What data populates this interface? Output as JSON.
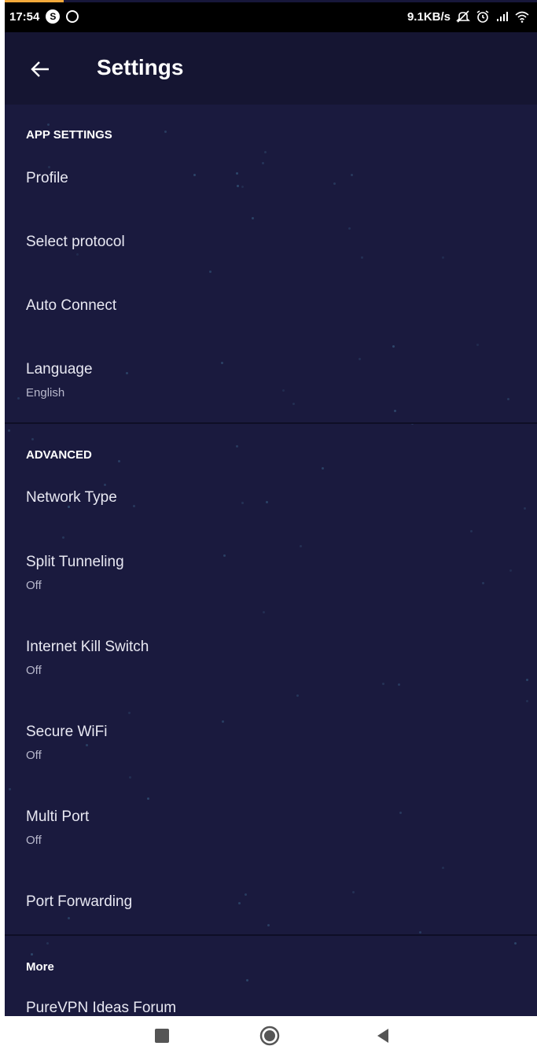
{
  "status_bar": {
    "time": "17:54",
    "left_icons": [
      "s-badge-icon",
      "whatsapp-icon"
    ],
    "net_speed": "9.1KB/s",
    "right_icons": [
      "mute-icon",
      "alarm-icon",
      "signal-icon",
      "wifi-icon"
    ],
    "accent_color": "#f2a93b"
  },
  "app_bar": {
    "title": "Settings",
    "back_icon": "arrow-left-icon"
  },
  "theme": {
    "background": "#1a1a3e",
    "app_bar_bg": "#151532",
    "text": "#e8e8f2"
  },
  "sections": [
    {
      "header": "APP SETTINGS",
      "items": [
        {
          "title": "Profile"
        },
        {
          "title": "Select protocol"
        },
        {
          "title": "Auto Connect"
        },
        {
          "title": "Language",
          "subtitle": "English"
        }
      ]
    },
    {
      "header": "ADVANCED",
      "items": [
        {
          "title": "Network Type"
        },
        {
          "title": "Split Tunneling",
          "subtitle": "Off"
        },
        {
          "title": "Internet Kill Switch",
          "subtitle": "Off"
        },
        {
          "title": "Secure WiFi",
          "subtitle": "Off"
        },
        {
          "title": "Multi Port",
          "subtitle": "Off"
        },
        {
          "title": "Port Forwarding"
        }
      ]
    },
    {
      "header": "More",
      "items": [
        {
          "title": "PureVPN Ideas Forum"
        }
      ]
    }
  ],
  "nav_bar": {
    "buttons": [
      "recents-square-icon",
      "home-circle-icon",
      "back-triangle-icon"
    ]
  }
}
